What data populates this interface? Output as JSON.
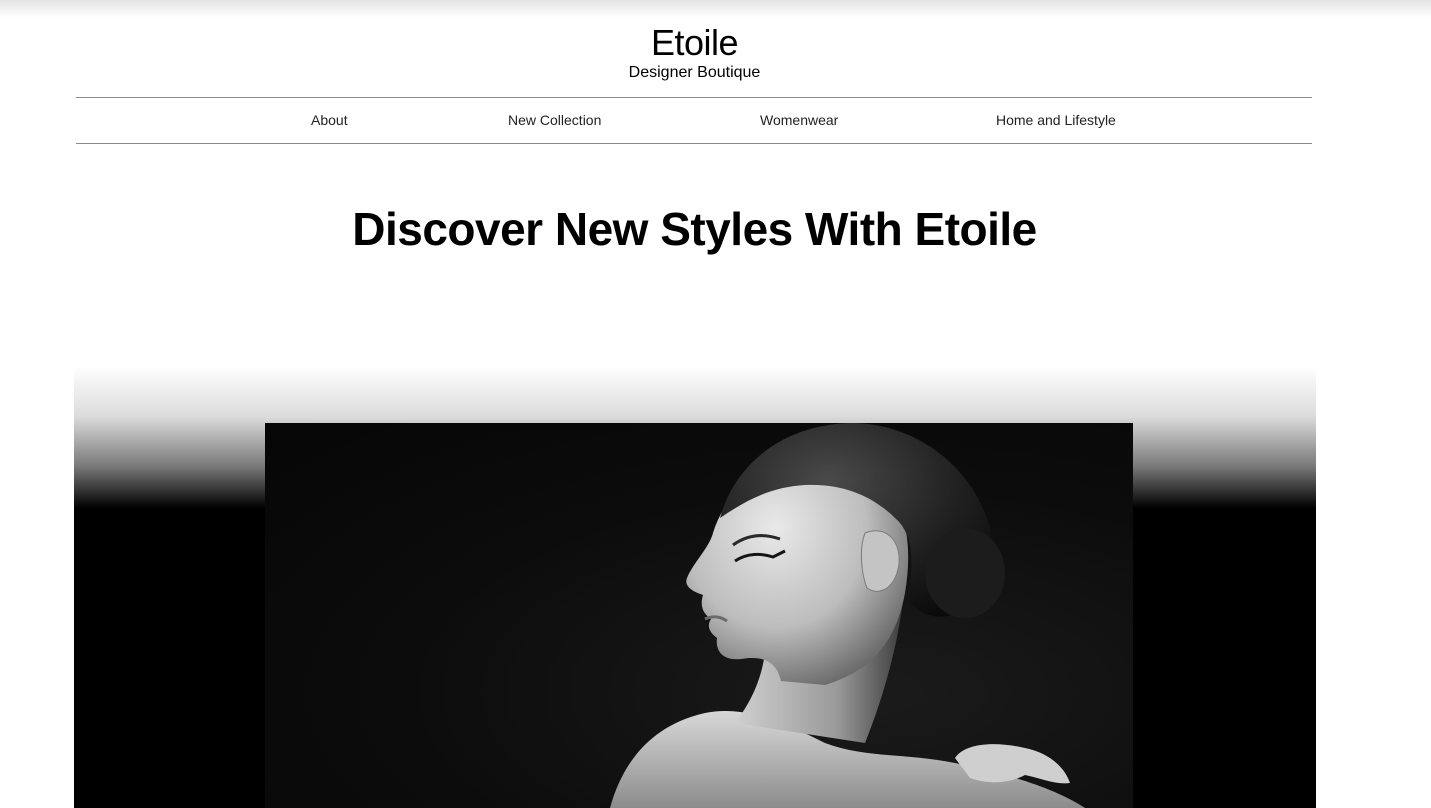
{
  "brand": {
    "name": "Etoile",
    "tagline": "Designer Boutique"
  },
  "nav": {
    "items": [
      {
        "label": "About"
      },
      {
        "label": "New Collection"
      },
      {
        "label": "Womenwear"
      },
      {
        "label": "Home and Lifestyle"
      }
    ]
  },
  "hero": {
    "headline": "Discover New Styles With Etoile",
    "image_subject": "black-and-white portrait of a woman in profile"
  },
  "colors": {
    "text": "#000000",
    "background": "#ffffff",
    "divider": "#8a8a8a",
    "hero_background": "#000000"
  }
}
